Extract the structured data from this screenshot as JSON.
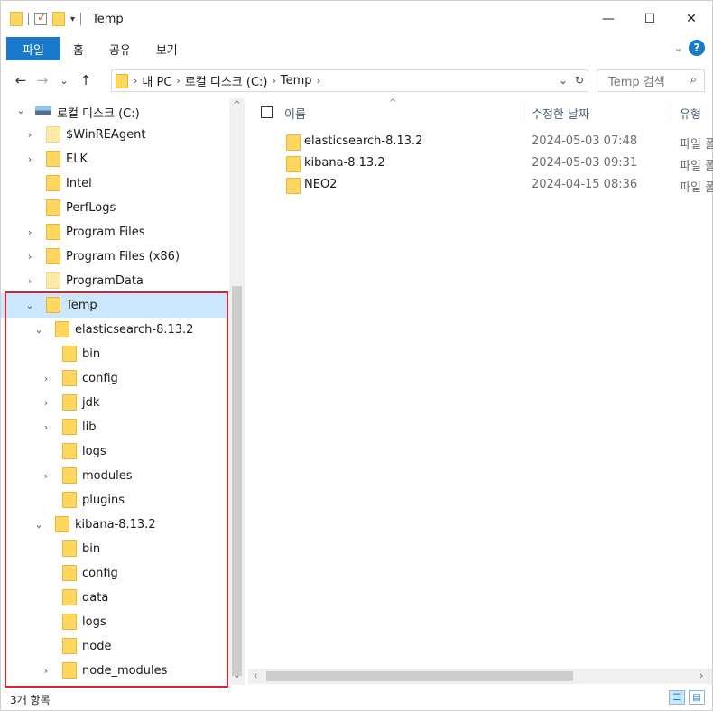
{
  "window": {
    "title": "Temp",
    "controls": {
      "minimize": "—",
      "maximize": "☐",
      "close": "✕"
    }
  },
  "quick_access": {
    "dropdown": "▾"
  },
  "ribbon": {
    "tabs": [
      "파일",
      "홈",
      "공유",
      "보기"
    ],
    "expand": "⌄",
    "help": "?"
  },
  "nav": {
    "back": "←",
    "forward": "→",
    "recent": "⌄",
    "up": "↑",
    "breadcrumb": [
      "내 PC",
      "로컬 디스크 (C:)",
      "Temp"
    ],
    "dropdown": "⌄",
    "refresh": "↻",
    "search_placeholder": "Temp 검색",
    "search_icon": "⌕"
  },
  "tree": [
    {
      "label": "로컬 디스크 (C:)",
      "expander": "⌄",
      "icon": "drive-icon"
    },
    {
      "label": "$WinREAgent",
      "expander": "›",
      "icon": "folder-icon"
    },
    {
      "label": "ELK",
      "expander": "›",
      "icon": "folder-icon"
    },
    {
      "label": "Intel",
      "expander": "",
      "icon": "folder-icon"
    },
    {
      "label": "PerfLogs",
      "expander": "",
      "icon": "folder-icon"
    },
    {
      "label": "Program Files",
      "expander": "›",
      "icon": "folder-icon"
    },
    {
      "label": "Program Files (x86)",
      "expander": "›",
      "icon": "folder-icon"
    },
    {
      "label": "ProgramData",
      "expander": "›",
      "icon": "folder-icon"
    },
    {
      "label": "Temp",
      "expander": "⌄",
      "icon": "folder-icon",
      "selected": true
    },
    {
      "label": "elasticsearch-8.13.2",
      "expander": "⌄",
      "icon": "folder-icon"
    },
    {
      "label": "bin",
      "expander": "",
      "icon": "folder-icon"
    },
    {
      "label": "config",
      "expander": "›",
      "icon": "folder-icon"
    },
    {
      "label": "jdk",
      "expander": "›",
      "icon": "folder-icon"
    },
    {
      "label": "lib",
      "expander": "›",
      "icon": "folder-icon"
    },
    {
      "label": "logs",
      "expander": "",
      "icon": "folder-icon"
    },
    {
      "label": "modules",
      "expander": "›",
      "icon": "folder-icon"
    },
    {
      "label": "plugins",
      "expander": "",
      "icon": "folder-icon"
    },
    {
      "label": "kibana-8.13.2",
      "expander": "⌄",
      "icon": "folder-icon"
    },
    {
      "label": "bin",
      "expander": "",
      "icon": "folder-icon"
    },
    {
      "label": "config",
      "expander": "",
      "icon": "folder-icon"
    },
    {
      "label": "data",
      "expander": "",
      "icon": "folder-icon"
    },
    {
      "label": "logs",
      "expander": "",
      "icon": "folder-icon"
    },
    {
      "label": "node",
      "expander": "",
      "icon": "folder-icon"
    },
    {
      "label": "node_modules",
      "expander": "›",
      "icon": "folder-icon"
    }
  ],
  "columns": {
    "name": "이름",
    "date": "수정한 날짜",
    "type": "유형",
    "sort_indicator": "^"
  },
  "files": [
    {
      "name": "elasticsearch-8.13.2",
      "date": "2024-05-03 07:48",
      "type": "파일 폴더"
    },
    {
      "name": "kibana-8.13.2",
      "date": "2024-05-03 09:31",
      "type": "파일 폴더"
    },
    {
      "name": "NEO2",
      "date": "2024-04-15 08:36",
      "type": "파일 폴더"
    }
  ],
  "scroll": {
    "up": "^",
    "down": "⌄",
    "left": "‹",
    "right": "›"
  },
  "status": {
    "item_count": "3개 항목",
    "details_view": "☰",
    "tiles_view": "▤"
  },
  "colors": {
    "accent": "#1979ca",
    "selection": "#cce8ff",
    "highlight_box": "#e2202b",
    "folder": "#ffd75e"
  }
}
